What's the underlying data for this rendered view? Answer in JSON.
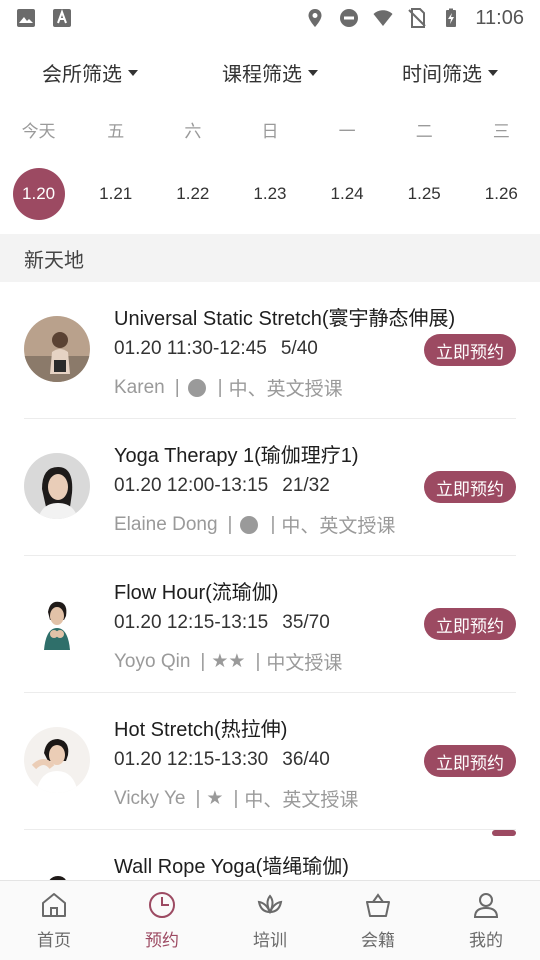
{
  "status_bar": {
    "time": "11:06",
    "left_icons": [
      "image-icon",
      "a-app-icon"
    ],
    "right_icons": [
      "location-icon",
      "do-not-disturb-icon",
      "wifi-icon",
      "no-sim-icon",
      "battery-charging-icon"
    ]
  },
  "filters": [
    {
      "label": "会所筛选"
    },
    {
      "label": "课程筛选"
    },
    {
      "label": "时间筛选"
    }
  ],
  "weekdays": [
    "今天",
    "五",
    "六",
    "日",
    "一",
    "二",
    "三"
  ],
  "dates": [
    "1.20",
    "1.21",
    "1.22",
    "1.23",
    "1.24",
    "1.25",
    "1.26"
  ],
  "selected_date_index": 0,
  "section": {
    "title": "新天地"
  },
  "courses": [
    {
      "title": "Universal Static Stretch(寰宇静态伸展)",
      "time": "01.20 11:30-12:45",
      "capacity": "5/40",
      "teacher": "Karen",
      "level": "●",
      "lang": "中、英文授课",
      "button": "立即预约"
    },
    {
      "title": "Yoga Therapy 1(瑜伽理疗1)",
      "time": "01.20 12:00-13:15",
      "capacity": "21/32",
      "teacher": "Elaine Dong",
      "level": "●",
      "lang": "中、英文授课",
      "button": "立即预约"
    },
    {
      "title": "Flow Hour(流瑜伽)",
      "time": "01.20 12:15-13:15",
      "capacity": "35/70",
      "teacher": "Yoyo Qin",
      "level": "★★",
      "lang": "中文授课",
      "button": "立即预约"
    },
    {
      "title": "Hot Stretch(热拉伸)",
      "time": "01.20 12:15-13:30",
      "capacity": "36/40",
      "teacher": "Vicky Ye",
      "level": "★",
      "lang": "中、英文授课",
      "button": "立即预约"
    },
    {
      "title": "Wall Rope Yoga(墙绳瑜伽)",
      "time": "",
      "capacity": "",
      "teacher": "",
      "level": "",
      "lang": "",
      "button": ""
    }
  ],
  "bottom_nav": [
    {
      "label": "首页",
      "icon": "home-icon"
    },
    {
      "label": "预约",
      "icon": "clock-icon"
    },
    {
      "label": "培训",
      "icon": "lotus-icon"
    },
    {
      "label": "会籍",
      "icon": "basket-icon"
    },
    {
      "label": "我的",
      "icon": "person-icon"
    }
  ],
  "active_nav_index": 1,
  "colors": {
    "accent": "#9c4a62",
    "section_bg": "#f3f3f3",
    "muted_text": "#9a9a9a"
  }
}
